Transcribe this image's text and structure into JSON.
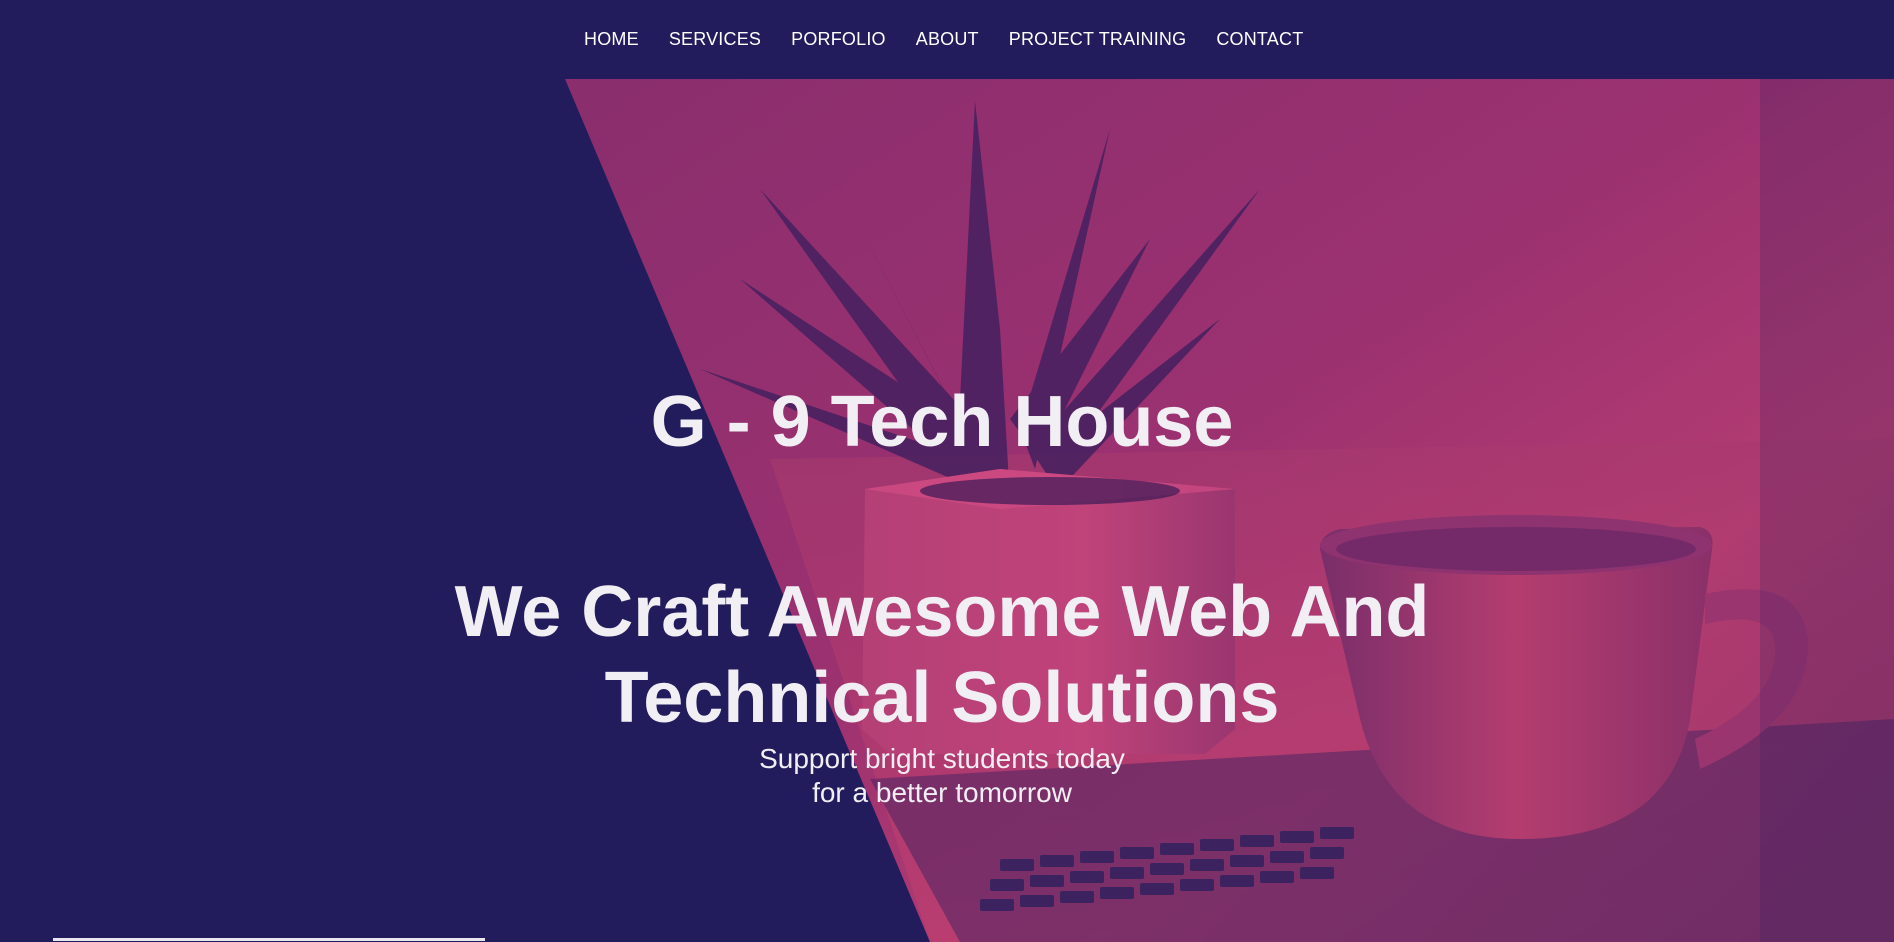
{
  "nav": {
    "items": [
      {
        "label": "HOME"
      },
      {
        "label": "SERVICES"
      },
      {
        "label": "PORFOLIO"
      },
      {
        "label": "ABOUT"
      },
      {
        "label": "PROJECT TRAINING"
      },
      {
        "label": "CONTACT"
      }
    ]
  },
  "hero": {
    "title": "G - 9 Tech House",
    "headline_line1": "We Craft Awesome Web And",
    "headline_line2": "Technical Solutions",
    "sub_line1": "Support bright students today",
    "sub_line2": "for a better tomorrow"
  },
  "colors": {
    "background": "#221c5c",
    "overlay_magenta": "#b8396f",
    "text": "#f1eef4"
  }
}
